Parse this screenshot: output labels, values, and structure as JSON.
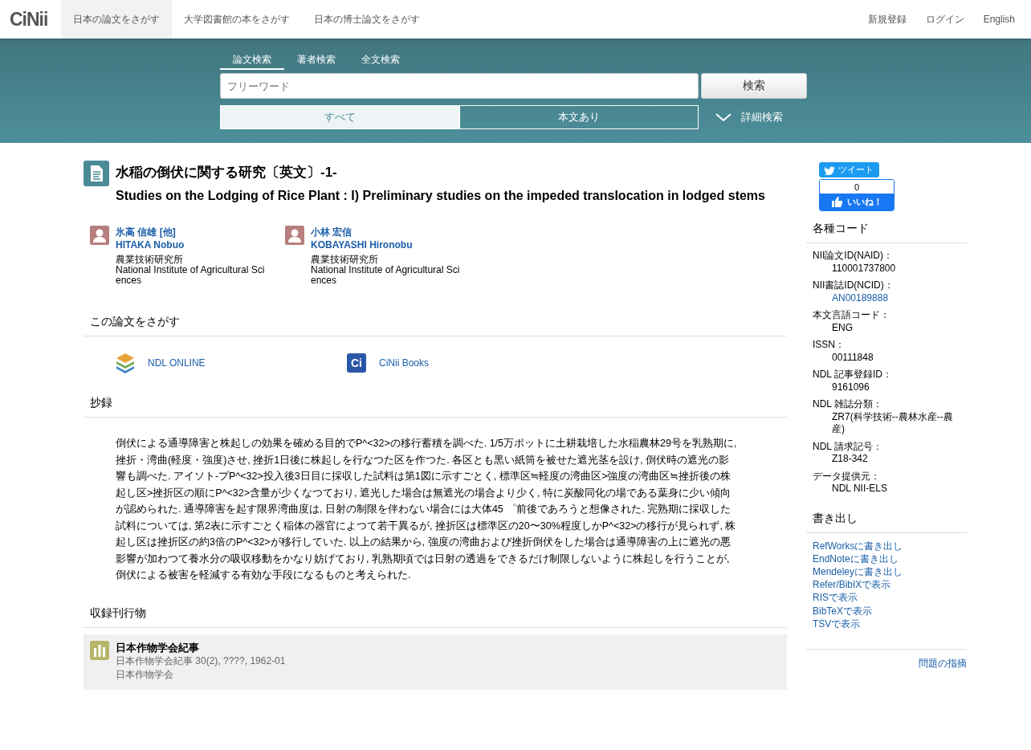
{
  "header": {
    "logo": "CiNii",
    "nav": [
      {
        "label": "日本の論文をさがす",
        "selected": true
      },
      {
        "label": "大学図書館の本をさがす",
        "selected": false
      },
      {
        "label": "日本の博士論文をさがす",
        "selected": false
      }
    ],
    "links": [
      "新規登録",
      "ログイン",
      "English"
    ]
  },
  "search": {
    "tabs": [
      {
        "label": "論文検索",
        "selected": true
      },
      {
        "label": "著者検索",
        "selected": false
      },
      {
        "label": "全文検索",
        "selected": false
      }
    ],
    "placeholder": "フリーワード",
    "button": "検索",
    "filters": [
      {
        "label": "すべて",
        "selected": true
      },
      {
        "label": "本文あり",
        "selected": false
      }
    ],
    "advanced": "詳細検索"
  },
  "article": {
    "title_ja": "水稲の倒伏に関する研究〔英文〕-1-",
    "title_en": "Studies on the Lodging of Rice Plant : I) Preliminary studies on the impeded translocation in lodged stems",
    "authors": [
      {
        "name_ja": "氷高 信雄 [他]",
        "name_en": "HITAKA Nobuo",
        "affiliation_ja": "農業技術研究所",
        "affiliation_en": "National Institute of Agricultural Sciences"
      },
      {
        "name_ja": "小林 宏信",
        "name_en": "KOBAYASHI Hironobu",
        "affiliation_ja": "農業技術研究所",
        "affiliation_en": "National Institute of Agricultural Sciences"
      }
    ],
    "find_heading": "この論文をさがす",
    "find_links": [
      {
        "kind": "ndl",
        "label": "NDL ONLINE"
      },
      {
        "kind": "books",
        "label": "CiNii Books",
        "icon_text": "Ci"
      }
    ],
    "abstract_heading": "抄録",
    "abstract": "倒伏による通導障害と株起しの効果を確める目的でP^<32>の移行蓄積を調べた. 1/5万ポットに土耕栽培した水稲農林29号を乳熟期に, 挫折・湾曲(軽度・強度)させ, 挫折1日後に株起しを行なつた区を作つた. 各区とも黒い紙筒を被せた遮光茎を設け, 倒伏時の遮光の影響も調べた. アイソト-プP^<32>投入後3日目に採収した試料は第1図に示すごとく, 標準区≒軽度の湾曲区>強度の湾曲区≒挫折後の株起し区>挫折区の順にP^<32>含量が少くなつており, 遮光した場合は無遮光の場合より少く, 特に炭酸同化の場である葉身に少い傾向が認められた. 通導障害を起す限界湾曲度は, 日射の制限を伴わない場合には大体45 ゜前後であろうと想像された. 完熟期に採収した試料については, 第2表に示すごとく稲体の器官によつて若干異るが, 挫折区は標準区の20〜30%程度しかP^<32>の移行が見られず, 株起し区は挫折区の約3倍のP^<32>が移行していた. 以上の結果から, 強度の湾曲および挫折倒伏をした場合は通導障害の上に遮光の悪影響が加わつて養水分の吸収移動をかなり妨げており, 乳熟期頃では日射の透過をできるだけ制限しないように株起しを行うことが, 倒伏による被害を軽減する有効な手段になるものと考えられた.",
    "journal_heading": "収録刊行物",
    "journal": {
      "title": "日本作物学会紀事",
      "detail": "日本作物学会紀事 30(2), ????, 1962-01",
      "publisher": "日本作物学会"
    }
  },
  "sidebar": {
    "tweet": "ツイート",
    "like_count": "0",
    "like": "いいね！",
    "codes_heading": "各種コード",
    "codes": [
      {
        "label": "NII論文ID(NAID)：",
        "value": "110001737800",
        "kind": "text"
      },
      {
        "label": "NII書誌ID(NCID)：",
        "value": "AN00189888",
        "kind": "link"
      },
      {
        "label": "本文言語コード：",
        "value": "ENG",
        "kind": "text"
      },
      {
        "label": "ISSN：",
        "value": "00111848",
        "kind": "text"
      },
      {
        "label": "NDL 記事登録ID：",
        "value": "9161096",
        "kind": "text"
      },
      {
        "label": "NDL 雑誌分類：",
        "value": "ZR7(科学技術--農林水産--農産)",
        "kind": "text"
      },
      {
        "label": "NDL 請求記号：",
        "value": "Z18-342",
        "kind": "text"
      },
      {
        "label": "データ提供元：",
        "value": "NDL  NII-ELS",
        "kind": "text"
      }
    ],
    "export_heading": "書き出し",
    "exports": [
      "RefWorksに書き出し",
      "EndNoteに書き出し",
      "Mendeleyに書き出し",
      "Refer/BibIXで表示",
      "RISで表示",
      "BibTeXで表示",
      "TSVで表示"
    ],
    "report": "問題の指摘"
  }
}
